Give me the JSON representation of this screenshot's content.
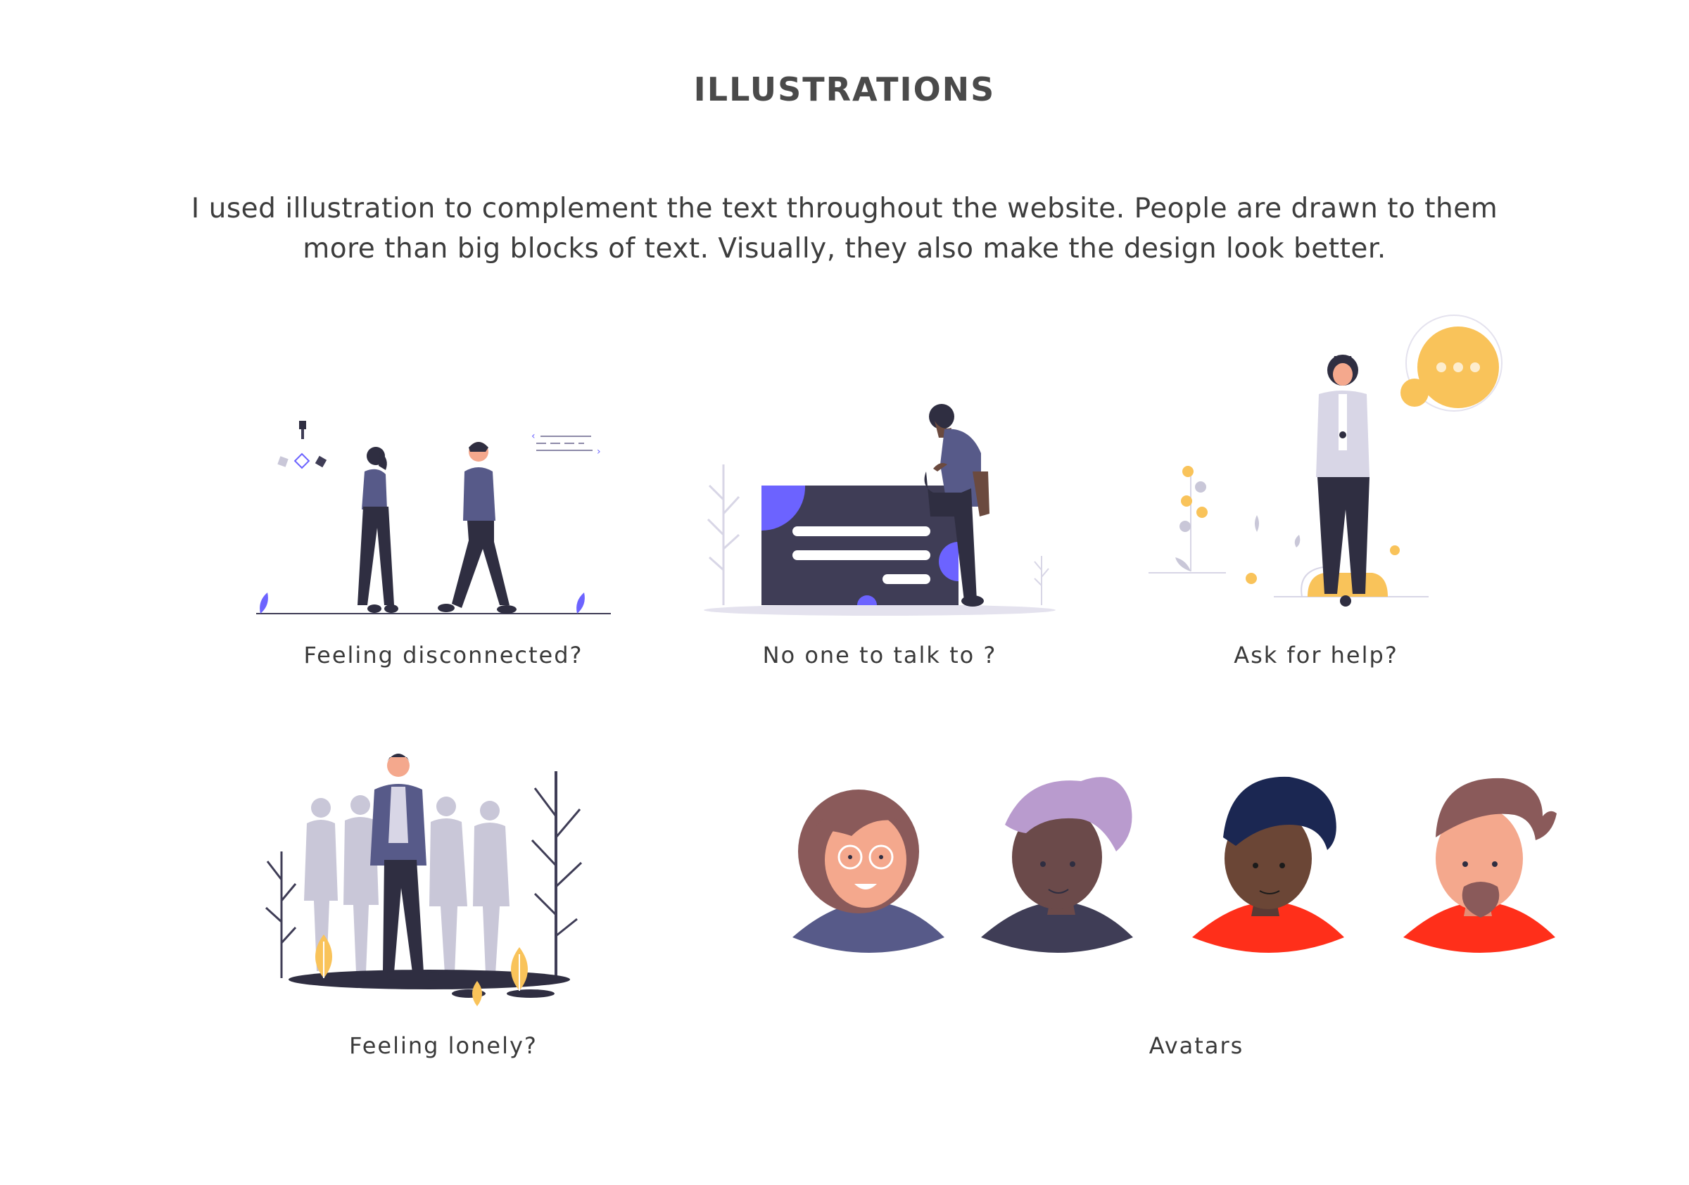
{
  "heading": "ILLUSTRATIONS",
  "intro": {
    "line1": "I used illustration to complement the text throughout the website. People are drawn to them",
    "line2": "more than big blocks of text. Visually, they also make the design look better."
  },
  "illustrations": [
    {
      "caption": "Feeling disconnected?"
    },
    {
      "caption": "No one to talk to ?"
    },
    {
      "caption": "Ask for help?"
    },
    {
      "caption": "Feeling lonely?"
    },
    {
      "caption": "Avatars"
    }
  ],
  "colors": {
    "text": "#3d3d3d",
    "figure_dark": "#2f2e41",
    "figure_purple": "#575a89",
    "accent_violet": "#6c63ff",
    "accent_yellow": "#f9c35a",
    "ghost": "#c9c7d8",
    "avatar_red": "#ff2f1a"
  },
  "icons": [
    "people-walking-icon",
    "man-on-sign-icon",
    "woman-chat-bubble-icon",
    "lonely-crowd-icon",
    "avatar-faces-icon"
  ]
}
